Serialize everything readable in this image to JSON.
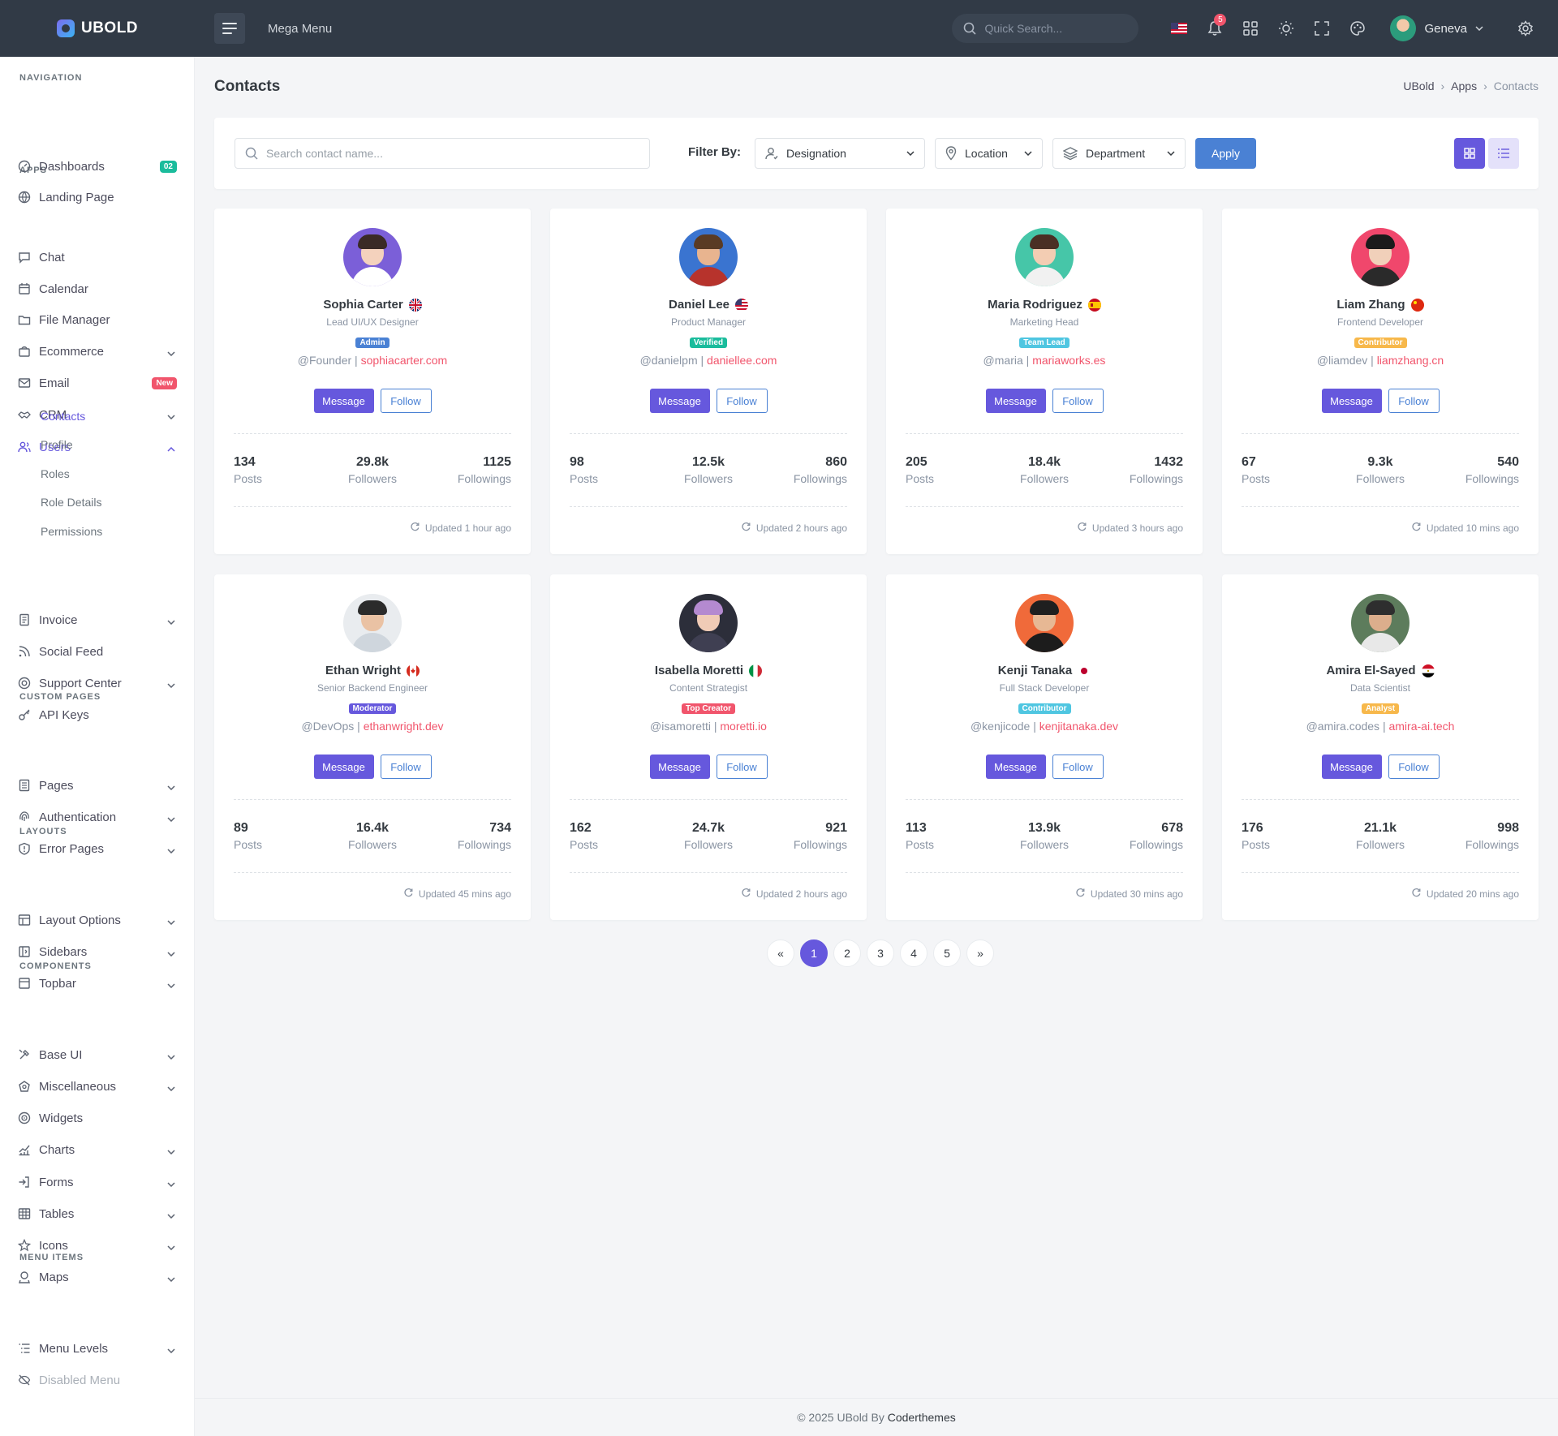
{
  "topbar": {
    "brand": "UBOLD",
    "mega_menu": "Mega Menu",
    "search_placeholder": "Quick Search...",
    "notifications_count": "5",
    "user_name": "Geneva"
  },
  "sidebar": {
    "sections": {
      "navigation": "NAVIGATION",
      "apps": "APPS",
      "custom_pages": "CUSTOM PAGES",
      "layouts": "LAYOUTS",
      "components": "COMPONENTS",
      "menu_items": "MENU ITEMS"
    },
    "items": [
      {
        "label": "Dashboards",
        "badge": "02",
        "badge_color": "#1abc9c",
        "icon": "dashboard-icon"
      },
      {
        "label": "Landing Page",
        "icon": "globe-icon"
      },
      {
        "label": "Chat",
        "icon": "chat-icon"
      },
      {
        "label": "Calendar",
        "icon": "calendar-icon"
      },
      {
        "label": "File Manager",
        "icon": "folder-icon"
      },
      {
        "label": "Ecommerce",
        "icon": "bag-icon"
      },
      {
        "label": "Email",
        "badge": "New",
        "badge_color": "#f1556c",
        "icon": "mail-icon"
      },
      {
        "label": "CRM",
        "icon": "handshake-icon"
      },
      {
        "label": "Users",
        "icon": "users-icon"
      },
      {
        "label": "Invoice",
        "icon": "invoice-icon"
      },
      {
        "label": "Social Feed",
        "icon": "rss-icon"
      },
      {
        "label": "Support Center",
        "icon": "lifebuoy-icon"
      },
      {
        "label": "API Keys",
        "icon": "key-icon"
      },
      {
        "label": "Pages",
        "icon": "pages-icon"
      },
      {
        "label": "Authentication",
        "icon": "fingerprint-icon"
      },
      {
        "label": "Error Pages",
        "icon": "alert-icon"
      },
      {
        "label": "Layout Options",
        "icon": "layout-icon"
      },
      {
        "label": "Sidebars",
        "icon": "sidebar-icon"
      },
      {
        "label": "Topbar",
        "icon": "topbar-icon"
      },
      {
        "label": "Base UI",
        "icon": "tools-icon"
      },
      {
        "label": "Miscellaneous",
        "icon": "misc-icon"
      },
      {
        "label": "Widgets",
        "icon": "widgets-icon"
      },
      {
        "label": "Charts",
        "icon": "chart-icon"
      },
      {
        "label": "Forms",
        "icon": "forms-icon"
      },
      {
        "label": "Tables",
        "icon": "table-icon"
      },
      {
        "label": "Icons",
        "icon": "icons-icon"
      },
      {
        "label": "Maps",
        "icon": "map-icon"
      },
      {
        "label": "Menu Levels",
        "icon": "menu-levels-icon"
      },
      {
        "label": "Disabled Menu",
        "icon": "eye-off-icon"
      }
    ],
    "users_sub": [
      "Contacts",
      "Profile",
      "Roles",
      "Role Details",
      "Permissions"
    ]
  },
  "page": {
    "title": "Contacts",
    "breadcrumb": [
      "UBold",
      "Apps",
      "Contacts"
    ]
  },
  "filters": {
    "search_placeholder": "Search contact name...",
    "filter_label": "Filter By:",
    "designation": "Designation",
    "location": "Location",
    "department": "Department",
    "apply": "Apply"
  },
  "contacts": [
    {
      "name": "Sophia Carter",
      "role": "Lead UI/UX Designer",
      "badge": "Admin",
      "badge_color": "#4a81d4",
      "handle": "@Founder",
      "site": "sophiacarter.com",
      "posts": "134",
      "followers": "29.8k",
      "followings": "1125",
      "updated": "Updated 1 hour ago",
      "flag": "uk"
    },
    {
      "name": "Daniel Lee",
      "role": "Product Manager",
      "badge": "Verified",
      "badge_color": "#1abc9c",
      "handle": "@danielpm",
      "site": "daniellee.com",
      "posts": "98",
      "followers": "12.5k",
      "followings": "860",
      "updated": "Updated 2 hours ago",
      "flag": "us"
    },
    {
      "name": "Maria Rodriguez",
      "role": "Marketing Head",
      "badge": "Team Lead",
      "badge_color": "#4fc6e1",
      "handle": "@maria",
      "site": "mariaworks.es",
      "posts": "205",
      "followers": "18.4k",
      "followings": "1432",
      "updated": "Updated 3 hours ago",
      "flag": "es"
    },
    {
      "name": "Liam Zhang",
      "role": "Frontend Developer",
      "badge": "Contributor",
      "badge_color": "#f7b84b",
      "handle": "@liamdev",
      "site": "liamzhang.cn",
      "posts": "67",
      "followers": "9.3k",
      "followings": "540",
      "updated": "Updated 10 mins ago",
      "flag": "cn"
    },
    {
      "name": "Ethan Wright",
      "role": "Senior Backend Engineer",
      "badge": "Moderator",
      "badge_color": "#6658dd",
      "handle": "@DevOps",
      "site": "ethanwright.dev",
      "posts": "89",
      "followers": "16.4k",
      "followings": "734",
      "updated": "Updated 45 mins ago",
      "flag": "ca"
    },
    {
      "name": "Isabella Moretti",
      "role": "Content Strategist",
      "badge": "Top Creator",
      "badge_color": "#f1556c",
      "handle": "@isamoretti",
      "site": "moretti.io",
      "posts": "162",
      "followers": "24.7k",
      "followings": "921",
      "updated": "Updated 2 hours ago",
      "flag": "it"
    },
    {
      "name": "Kenji Tanaka",
      "role": "Full Stack Developer",
      "badge": "Contributor",
      "badge_color": "#4fc6e1",
      "handle": "@kenjicode",
      "site": "kenjitanaka.dev",
      "posts": "113",
      "followers": "13.9k",
      "followings": "678",
      "updated": "Updated 30 mins ago",
      "flag": "jp"
    },
    {
      "name": "Amira El-Sayed",
      "role": "Data Scientist",
      "badge": "Analyst",
      "badge_color": "#f7b84b",
      "handle": "@amira.codes",
      "site": "amira-ai.tech",
      "posts": "176",
      "followers": "21.1k",
      "followings": "998",
      "updated": "Updated 20 mins ago",
      "flag": "eg"
    }
  ],
  "stat_labels": {
    "posts": "Posts",
    "followers": "Followers",
    "followings": "Followings"
  },
  "buttons": {
    "message": "Message",
    "follow": "Follow"
  },
  "pagination": {
    "prev": "«",
    "pages": [
      "1",
      "2",
      "3",
      "4",
      "5"
    ],
    "next": "»",
    "active": "1"
  },
  "footer": {
    "prefix": "© 2025 UBold By",
    "company": "Coderthemes"
  },
  "colors": {
    "primary": "#6658dd",
    "info": "#4a81d4",
    "danger": "#f1556c",
    "topbar": "#313a46"
  }
}
